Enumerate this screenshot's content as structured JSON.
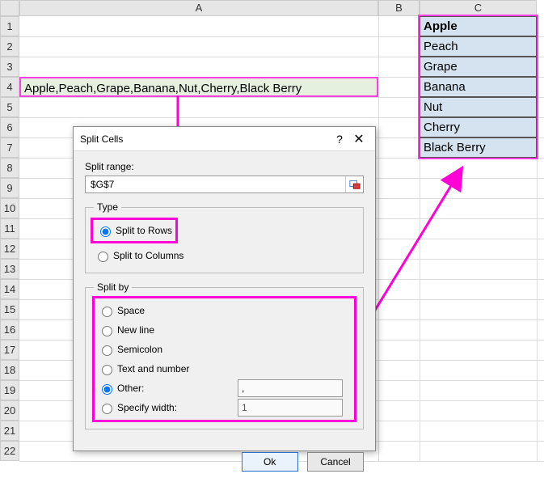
{
  "columns": {
    "A": "A",
    "B": "B",
    "C": "C"
  },
  "rows": [
    "1",
    "2",
    "3",
    "4",
    "5",
    "6",
    "7",
    "8",
    "9",
    "10",
    "11",
    "12",
    "13",
    "14",
    "15",
    "16",
    "17",
    "18",
    "19",
    "20",
    "21",
    "22"
  ],
  "cellA4": "Apple,Peach,Grape,Banana,Nut,Cherry,Black Berry",
  "result": [
    "Apple",
    "Peach",
    "Grape",
    "Banana",
    "Nut",
    "Cherry",
    "Black Berry"
  ],
  "dialog": {
    "title": "Split Cells",
    "help": "?",
    "close": "✕",
    "range_label": "Split range:",
    "range_value": "$G$7",
    "type_legend": "Type",
    "type_rows": "Split to Rows",
    "type_cols": "Split to Columns",
    "splitby_legend": "Split by",
    "splitby": {
      "space": "Space",
      "newline": "New line",
      "semicolon": "Semicolon",
      "textnum": "Text and number",
      "other": "Other:",
      "other_value": ",",
      "width": "Specify width:",
      "width_value": "1"
    },
    "ok": "Ok",
    "cancel": "Cancel"
  }
}
